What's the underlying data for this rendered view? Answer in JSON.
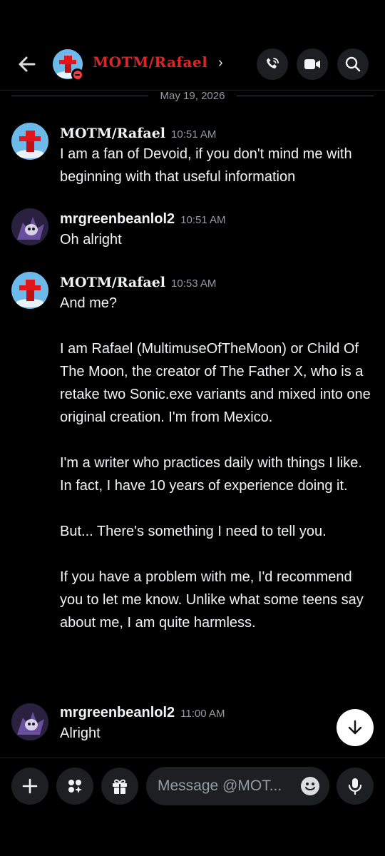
{
  "header": {
    "title": "MOTM/Rafael",
    "chevron": "›",
    "icons": [
      "back-arrow-icon",
      "phone-call-icon",
      "video-camera-icon",
      "search-icon"
    ],
    "status": "do-not-disturb"
  },
  "date_divider": "May 19, 2026",
  "messages": [
    {
      "author": "MOTM/Rafael",
      "time": "10:51 AM",
      "lines": [
        "I am a fan of Devoid, if you don't mind me with beginning with that useful information"
      ]
    },
    {
      "author": "mrgreenbeanlol2",
      "time": "10:51 AM",
      "lines": [
        "Oh alright"
      ]
    },
    {
      "author": "MOTM/Rafael",
      "time": "10:53 AM",
      "paragraphs": [
        "And me?",
        "I am Rafael (MultimuseOfTheMoon) or Child Of The Moon, the creator of The Father X, who is a retake two Sonic.exe variants and mixed into one original creation. I'm from Mexico.",
        "I'm a writer who practices daily with things I like. In fact, I have 10 years of experience doing it.",
        "But... There's something I need to tell you.",
        "If you have a problem with me, I'd recommend you to let me know. Unlike what some teens say about me, I am quite harmless."
      ]
    },
    {
      "author": "mrgreenbeanlol2",
      "time": "11:00 AM",
      "lines": [
        "Alright"
      ]
    }
  ],
  "composer": {
    "placeholder": "Message @MOT...",
    "icons": [
      "plus-icon",
      "apps-icon",
      "gift-icon",
      "emoji-icon",
      "microphone-icon"
    ]
  },
  "colors": {
    "background": "#000000",
    "header_name": "#d9262a",
    "button_bg": "#1e1f22",
    "muted_text": "#949ba4",
    "dnd": "#f23f43"
  }
}
